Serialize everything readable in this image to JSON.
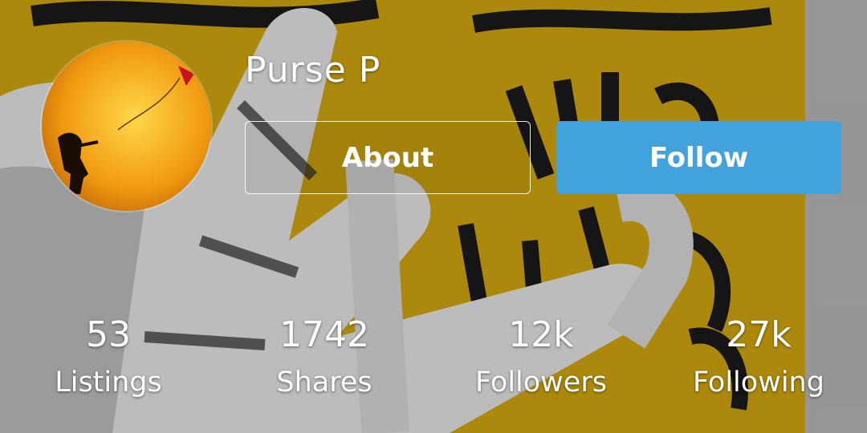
{
  "profile": {
    "username": "Purse P",
    "about_label": "About",
    "follow_label": "Follow"
  },
  "stats": [
    {
      "value": "53",
      "label": "Listings"
    },
    {
      "value": "1742",
      "label": "Shares"
    },
    {
      "value": "12k",
      "label": "Followers"
    },
    {
      "value": "27k",
      "label": "Following"
    }
  ],
  "colors": {
    "follow_button": "#42a3dc",
    "poster_yellow": "#d3a90f",
    "side_grey": "#b9b9b9"
  }
}
